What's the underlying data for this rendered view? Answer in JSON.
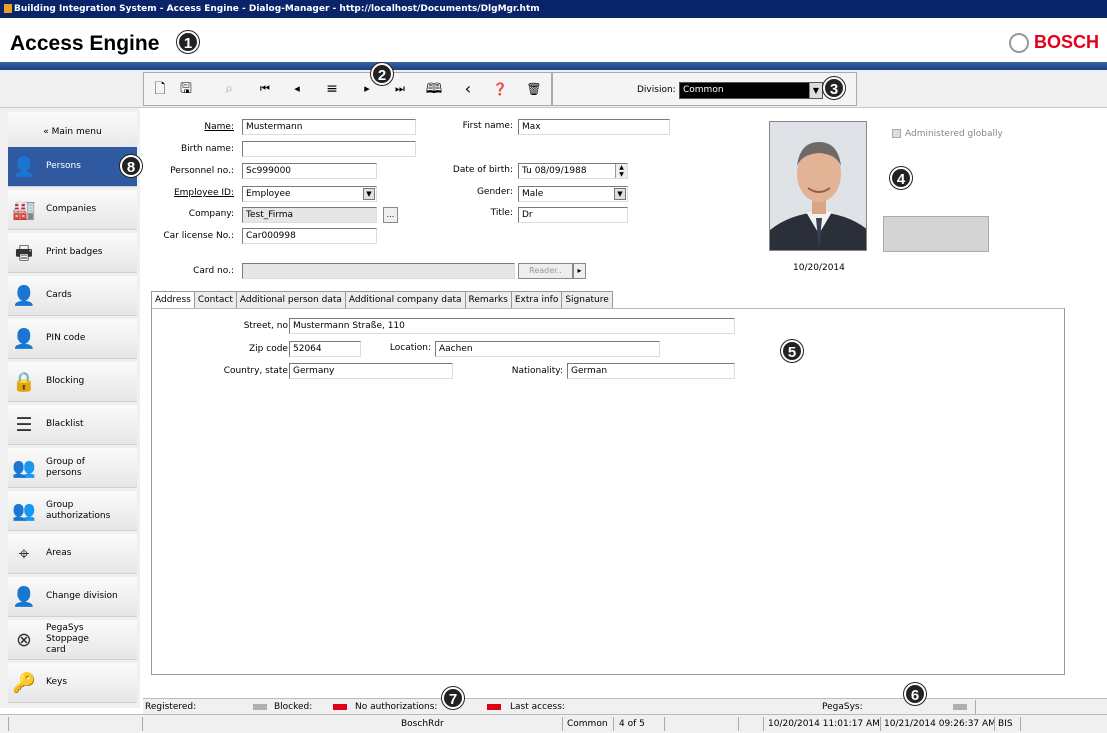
{
  "window": {
    "title": "Building Integration System - Access Engine - Dialog-Manager - http://localhost/Documents/DlgMgr.htm"
  },
  "header": {
    "app_title": "Access Engine",
    "brand": "BOSCH"
  },
  "callouts": [
    "1",
    "2",
    "3",
    "4",
    "5",
    "6",
    "7",
    "8"
  ],
  "toolbar": {
    "buttons": [
      {
        "name": "new",
        "icon": "new-document-icon"
      },
      {
        "name": "save",
        "icon": "save-icon"
      },
      {
        "name": "search",
        "icon": "search-icon",
        "disabled": true
      },
      {
        "name": "first",
        "icon": "first-record-icon"
      },
      {
        "name": "previous",
        "icon": "previous-record-icon"
      },
      {
        "name": "filter",
        "icon": "filter-search-icon"
      },
      {
        "name": "next",
        "icon": "next-record-icon"
      },
      {
        "name": "last",
        "icon": "last-record-icon"
      },
      {
        "name": "book",
        "icon": "book-icon"
      },
      {
        "name": "back",
        "icon": "back-icon"
      },
      {
        "name": "help",
        "icon": "help-icon"
      },
      {
        "name": "delete",
        "icon": "trash-icon"
      }
    ],
    "division_label": "Division:",
    "division_value": "Common"
  },
  "sidebar": {
    "main_menu": "« Main menu",
    "items": [
      {
        "label": "Persons",
        "icon": "person-icon",
        "active": true
      },
      {
        "label": "Companies",
        "icon": "factory-icon"
      },
      {
        "label": "Print badges",
        "icon": "printer-icon"
      },
      {
        "label": "Cards",
        "icon": "person-card-icon"
      },
      {
        "label": "PIN code",
        "icon": "person-keypad-icon"
      },
      {
        "label": "Blocking",
        "icon": "person-lock-icon"
      },
      {
        "label": "Blacklist",
        "icon": "blacklist-icon"
      },
      {
        "label": "Group of persons",
        "icon": "group-card-icon"
      },
      {
        "label": "Group authorizations",
        "icon": "group-key-icon"
      },
      {
        "label": "Areas",
        "icon": "crosshair-icon"
      },
      {
        "label": "Change division",
        "icon": "change-division-icon"
      },
      {
        "label": "PegaSys Stoppage card",
        "icon": "stoppage-card-icon"
      },
      {
        "label": "Keys",
        "icon": "key-icon"
      }
    ]
  },
  "form": {
    "name_label": "Name:",
    "name_value": "Mustermann",
    "first_name_label": "First name:",
    "first_name_value": "Max",
    "birth_name_label": "Birth name:",
    "birth_name_value": "",
    "personnel_label": "Personnel no.:",
    "personnel_value": "Sc999000",
    "dob_label": "Date of birth:",
    "dob_value": "Tu 08/09/1988",
    "employee_label": "Employee ID:",
    "employee_value": "Employee",
    "gender_label": "Gender:",
    "gender_value": "Male",
    "company_label": "Company:",
    "company_value": "Test_Firma",
    "company_btn": "...",
    "title_label": "Title:",
    "title_value": "Dr",
    "car_label": "Car license No.:",
    "car_value": "Car000998",
    "card_label": "Card no.:",
    "card_value": "",
    "reader_btn": "Reader..",
    "reader_arrow": "▸",
    "photo_date": "10/20/2014",
    "admin_global": "Administered globally"
  },
  "tabs": [
    "Address",
    "Contact",
    "Additional person data",
    "Additional company data",
    "Remarks",
    "Extra info",
    "Signature"
  ],
  "address": {
    "street_label": "Street, no:",
    "street_value": "Mustermann Straße, 110",
    "zip_label": "Zip code:",
    "zip_value": "52064",
    "location_label": "Location:",
    "location_value": "Aachen",
    "country_label": "Country, state:",
    "country_value": "Germany",
    "nationality_label": "Nationality:",
    "nationality_value": "German"
  },
  "status": {
    "registered": "Registered:",
    "blocked": "Blocked:",
    "no_auth": "No authorizations:",
    "last_access": "Last access:",
    "pegasys": "PegaSys:"
  },
  "bottom": {
    "reader": "BoschRdr",
    "division": "Common",
    "record": "4 of 5",
    "created": "10/20/2014 11:01:17 AM",
    "modified": "10/21/2014 09:26:37 AM",
    "system": "BIS"
  },
  "colors": {
    "title_bar": "#0a246a",
    "accent_blue": "#2f5aa2",
    "brand_red": "#e2001a",
    "led_red": "#e0001a",
    "led_gray": "#b0b0b0"
  }
}
